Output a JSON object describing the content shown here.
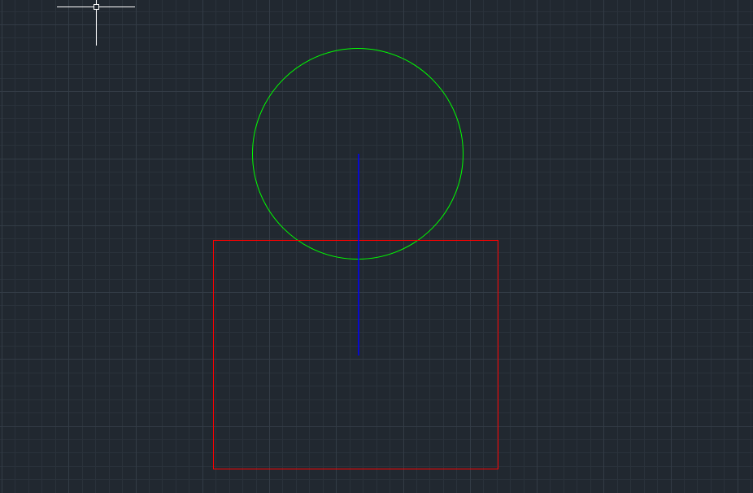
{
  "app": {
    "view": "model-space-canvas"
  },
  "colors": {
    "background": "#212830",
    "grid_minor": "#2a323b",
    "grid_major": "#333c46",
    "circle": "#00ff00",
    "line": "#0000ff",
    "rectangle": "#ff0000",
    "crosshair": "#ffffff"
  },
  "objects": [
    {
      "type": "circle",
      "layer_color": "green"
    },
    {
      "type": "line",
      "layer_color": "blue"
    },
    {
      "type": "rectangle",
      "layer_color": "red"
    }
  ],
  "cursor": {
    "icon": "crosshair-cursor-icon"
  }
}
